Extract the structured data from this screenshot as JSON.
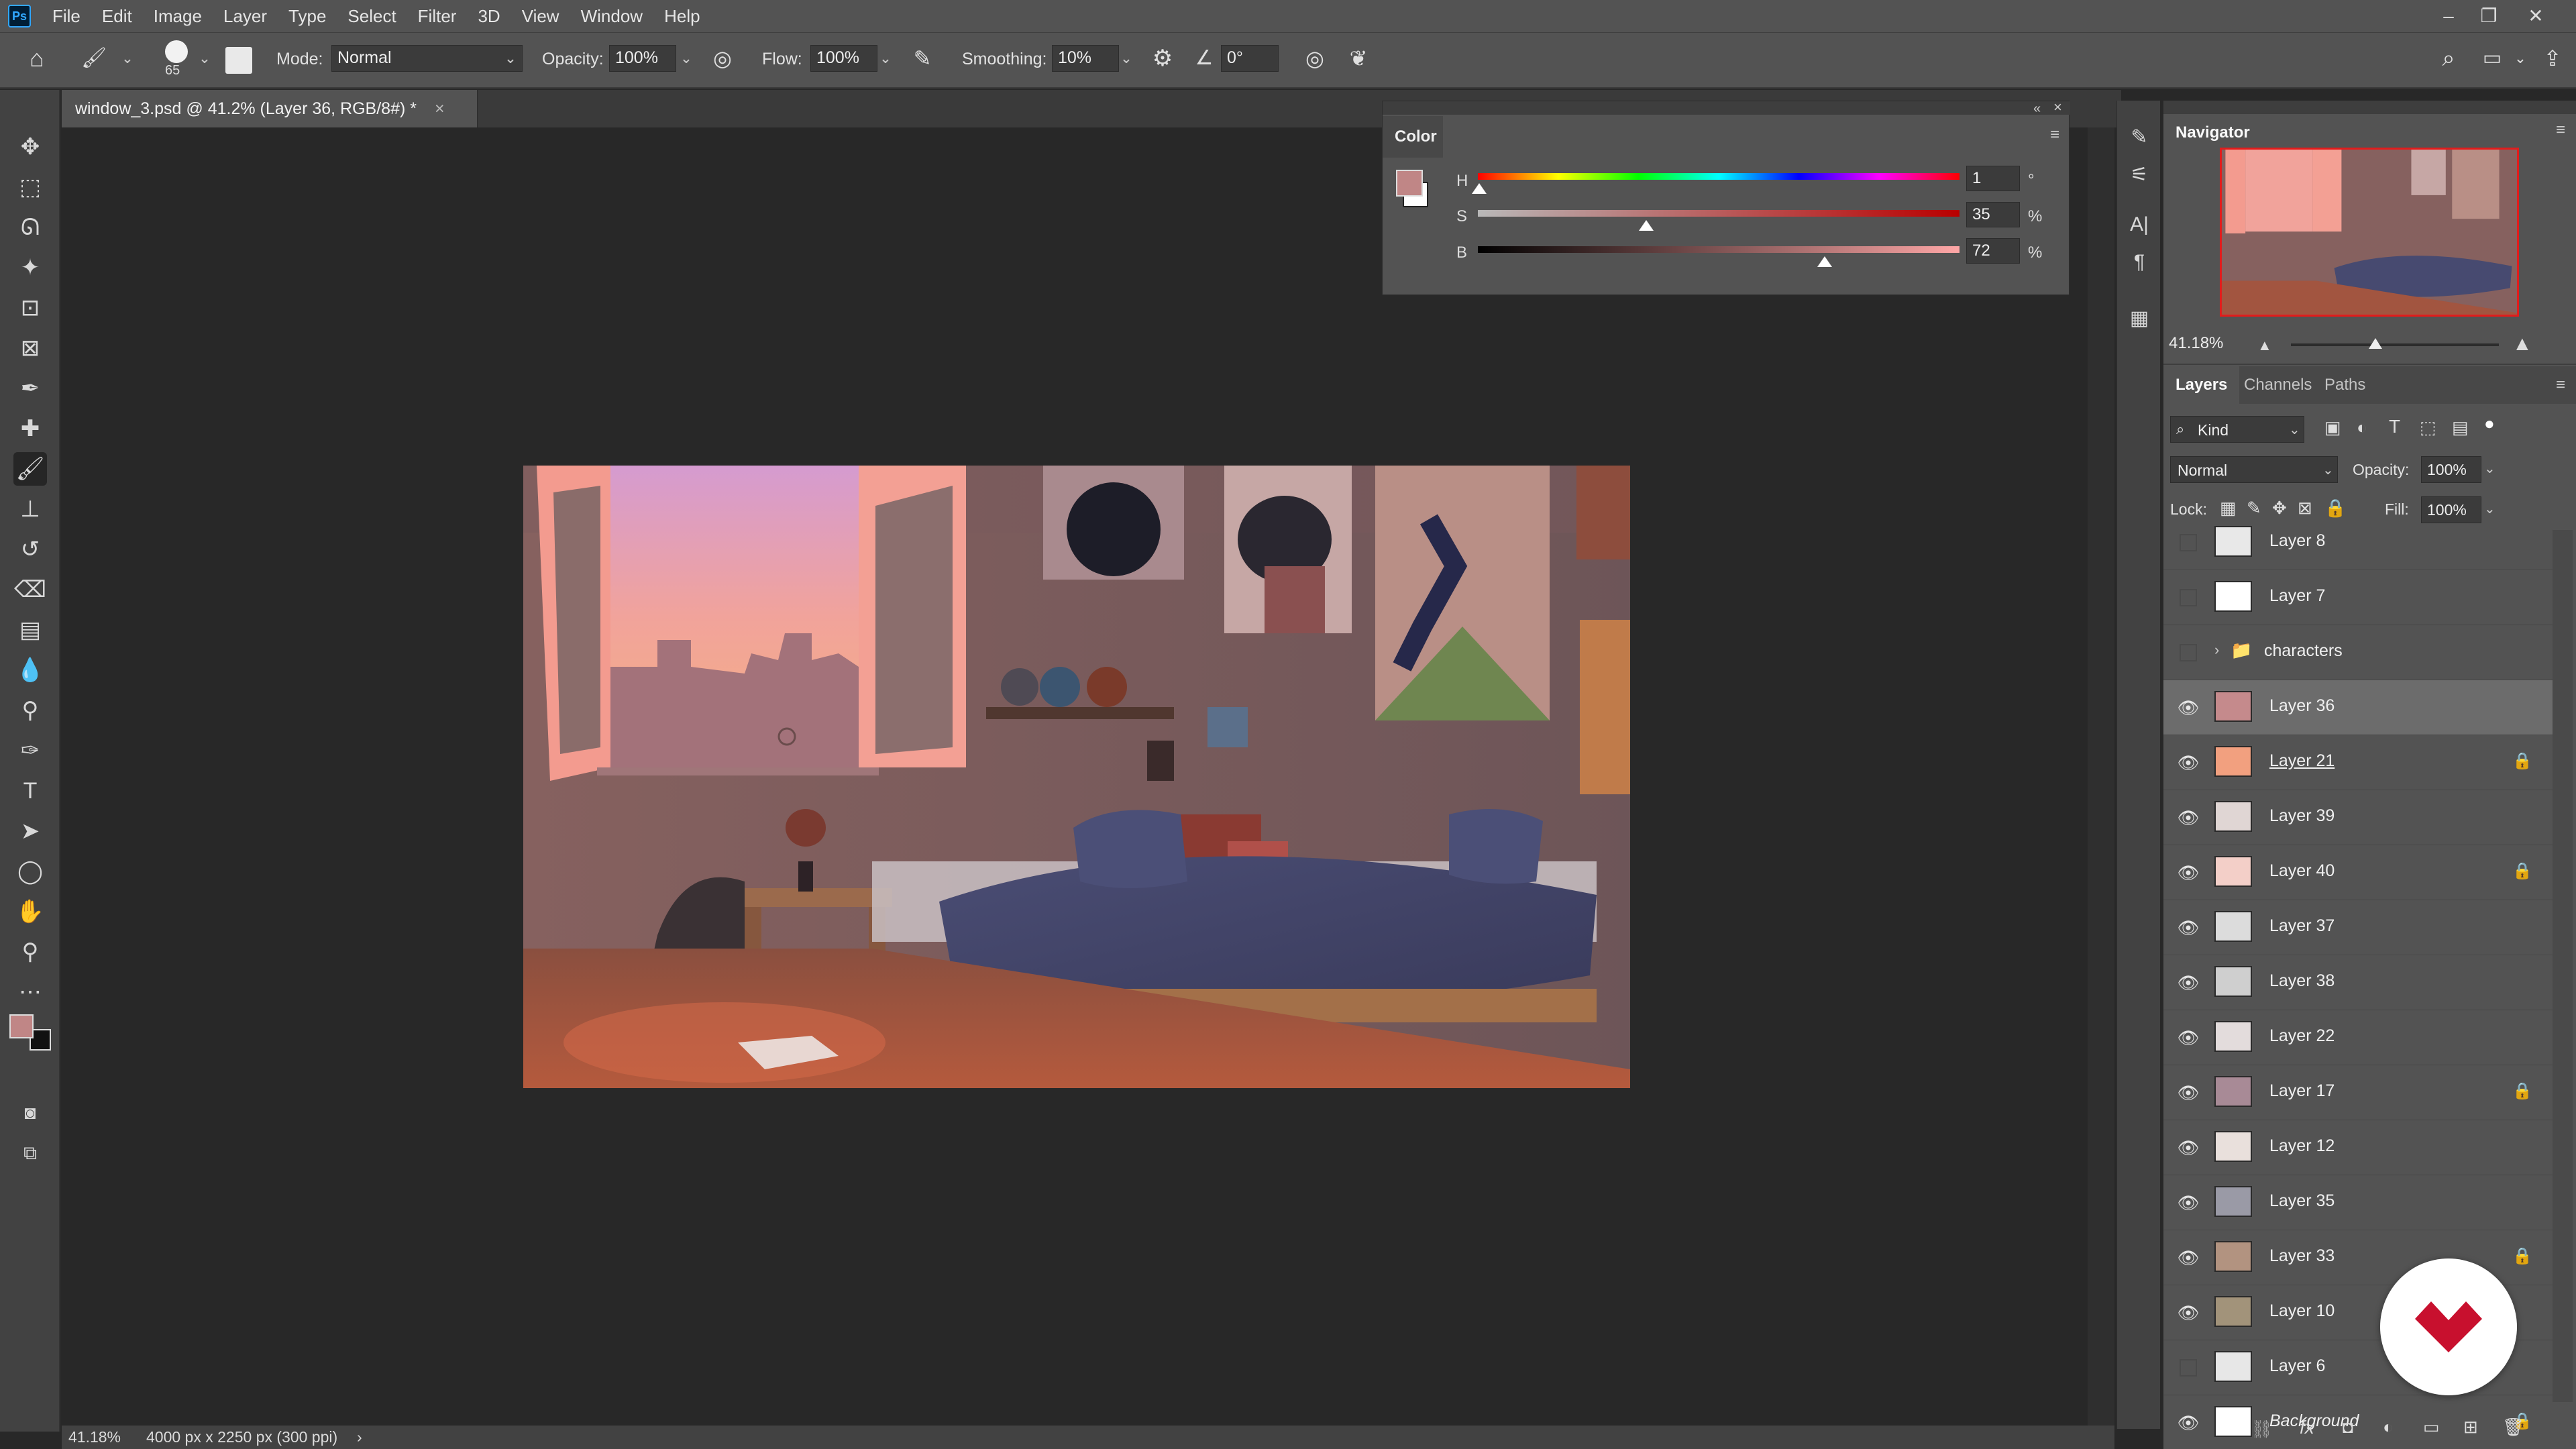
{
  "app": {
    "menu": [
      "File",
      "Edit",
      "Image",
      "Layer",
      "Type",
      "Select",
      "Filter",
      "3D",
      "View",
      "Window",
      "Help"
    ]
  },
  "options": {
    "brush_size": "65",
    "mode_label": "Mode:",
    "mode_value": "Normal",
    "opacity_label": "Opacity:",
    "opacity_value": "100%",
    "flow_label": "Flow:",
    "flow_value": "100%",
    "smoothing_label": "Smoothing:",
    "smoothing_value": "10%",
    "angle_value": "0°"
  },
  "document": {
    "tab_title": "window_3.psd @ 41.2% (Layer 36, RGB/8#) *",
    "close_glyph": "×"
  },
  "status": {
    "zoom": "41.18%",
    "dimensions": "4000 px x 2250 px (300 ppi)",
    "arrow": "›"
  },
  "color_panel": {
    "title": "Color",
    "foreground": "#c08686",
    "h_label": "H",
    "h_value": "1",
    "h_unit": "°",
    "s_label": "S",
    "s_value": "35",
    "s_unit": "%",
    "b_label": "B",
    "b_value": "72",
    "b_unit": "%",
    "h_fraction": 0.003,
    "s_fraction": 0.35,
    "b_fraction": 0.72
  },
  "navigator": {
    "title": "Navigator",
    "zoom": "41.18%"
  },
  "layers_panel": {
    "tabs": [
      "Layers",
      "Channels",
      "Paths"
    ],
    "filter_label": "Kind",
    "blend_mode": "Normal",
    "opacity_label": "Opacity:",
    "opacity_value": "100%",
    "lock_label": "Lock:",
    "fill_label": "Fill:",
    "fill_value": "100%",
    "layers": [
      {
        "name": "Layer 8",
        "visible": false,
        "locked": false
      },
      {
        "name": "Layer 7",
        "visible": false,
        "locked": false
      },
      {
        "name": "characters",
        "visible": false,
        "locked": false,
        "group": true
      },
      {
        "name": "Layer 36",
        "visible": true,
        "locked": false,
        "selected": true
      },
      {
        "name": "Layer 21",
        "visible": true,
        "locked": true
      },
      {
        "name": "Layer 39",
        "visible": true,
        "locked": false
      },
      {
        "name": "Layer 40",
        "visible": true,
        "locked": true
      },
      {
        "name": "Layer 37",
        "visible": true,
        "locked": false
      },
      {
        "name": "Layer 38",
        "visible": true,
        "locked": false
      },
      {
        "name": "Layer 22",
        "visible": true,
        "locked": false
      },
      {
        "name": "Layer 17",
        "visible": true,
        "locked": true
      },
      {
        "name": "Layer 12",
        "visible": true,
        "locked": false
      },
      {
        "name": "Layer 35",
        "visible": true,
        "locked": false
      },
      {
        "name": "Layer 33",
        "visible": true,
        "locked": true
      },
      {
        "name": "Layer 10",
        "visible": true,
        "locked": false
      },
      {
        "name": "Layer 6",
        "visible": false,
        "locked": false
      },
      {
        "name": "Background",
        "visible": true,
        "locked": true
      }
    ]
  },
  "colors": {
    "accent_red": "#c8102e"
  }
}
